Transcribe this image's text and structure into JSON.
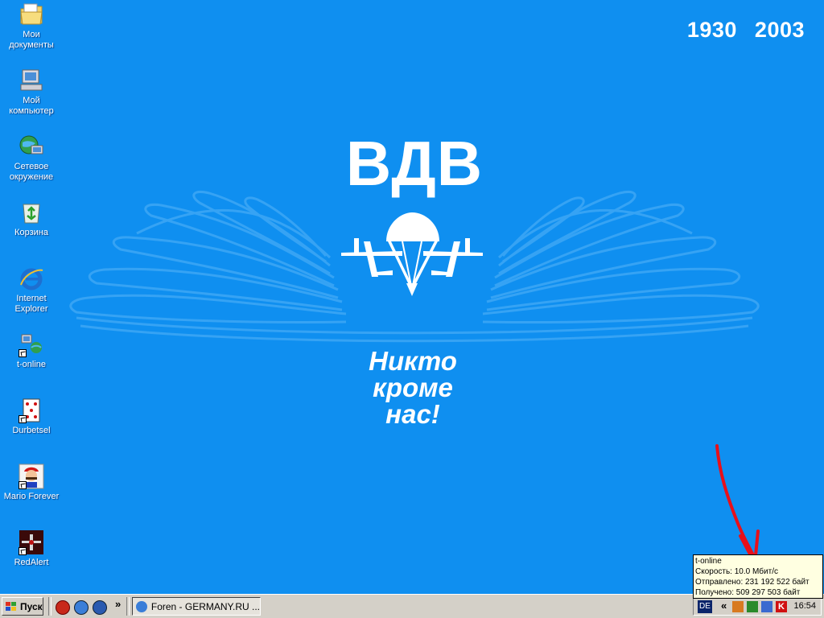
{
  "wallpaper": {
    "year_start": "1930",
    "year_end": "2003",
    "title": "ВДВ",
    "motto_line1": "Никто",
    "motto_line2": "кроме",
    "motto_line3": "нас!"
  },
  "desktop_icons": [
    {
      "label_line1": "Мои",
      "label_line2": "документы",
      "icon": "my-documents-icon"
    },
    {
      "label_line1": "Мой",
      "label_line2": "компьютер",
      "icon": "my-computer-icon"
    },
    {
      "label_line1": "Сетевое",
      "label_line2": "окружение",
      "icon": "network-icon"
    },
    {
      "label_line1": "Корзина",
      "label_line2": "",
      "icon": "recycle-bin-icon"
    },
    {
      "label_line1": "Internet",
      "label_line2": "Explorer",
      "icon": "internet-explorer-icon"
    },
    {
      "label_line1": "t-online",
      "label_line2": "",
      "icon": "t-online-icon"
    },
    {
      "label_line1": "Durbetsel",
      "label_line2": "",
      "icon": "playing-card-icon"
    },
    {
      "label_line1": "Mario Forever",
      "label_line2": "",
      "icon": "mario-icon"
    },
    {
      "label_line1": "RedAlert",
      "label_line2": "",
      "icon": "redalert-icon"
    }
  ],
  "taskbar": {
    "start_label": "Пуск",
    "chevron": "»",
    "task_label": "Foren - GERMANY.RU ...",
    "language": "DE",
    "tray_chevron": "«",
    "clock": "16:54"
  },
  "tooltip": {
    "line1": "t-online",
    "line2": "Скорость: 10.0 Мбит/с",
    "line3": "Отправлено: 231 192 522 байт",
    "line4": "Получено: 509 297 503 байт"
  },
  "colors": {
    "desktop": "#0f8ff0",
    "annotation_arrow": "#e8101a",
    "taskbar": "#d4d0c8"
  }
}
